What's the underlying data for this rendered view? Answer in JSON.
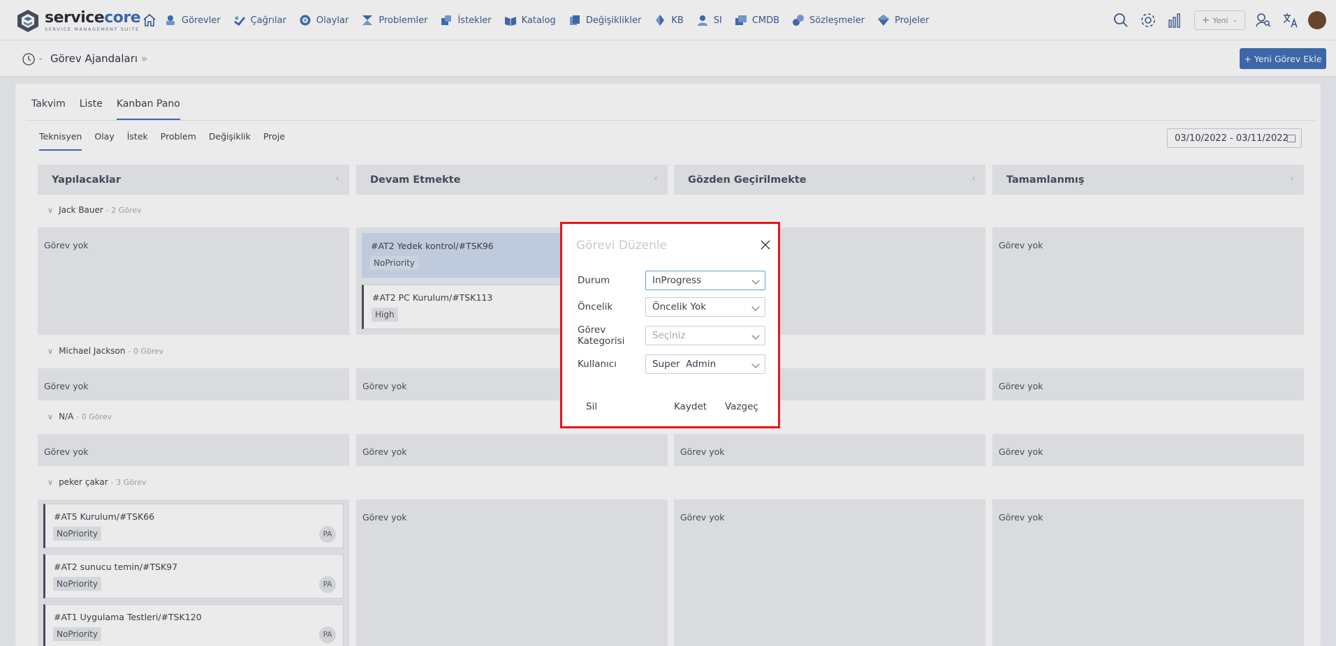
{
  "brand": {
    "name_a": "service",
    "name_b": "core",
    "tagline": "SERVICE MANAGEMENT SUITE"
  },
  "nav": [
    {
      "label": "Görevler",
      "icon": "tasks-icon"
    },
    {
      "label": "Çağrılar",
      "icon": "calls-icon"
    },
    {
      "label": "Olaylar",
      "icon": "incidents-icon"
    },
    {
      "label": "Problemler",
      "icon": "problems-icon"
    },
    {
      "label": "İstekler",
      "icon": "requests-icon"
    },
    {
      "label": "Katalog",
      "icon": "catalog-icon"
    },
    {
      "label": "Değişiklikler",
      "icon": "changes-icon"
    },
    {
      "label": "KB",
      "icon": "kb-icon"
    },
    {
      "label": "SI",
      "icon": "si-icon"
    },
    {
      "label": "CMDB",
      "icon": "cmdb-icon"
    },
    {
      "label": "Sözleşmeler",
      "icon": "contracts-icon"
    },
    {
      "label": "Projeler",
      "icon": "projects-icon"
    }
  ],
  "top_right": {
    "new_label": "Yeni"
  },
  "header": {
    "title": "Görev Ajandaları",
    "add_button": "+ Yeni Görev Ekle"
  },
  "view_tabs": [
    "Takvim",
    "Liste",
    "Kanban Pano"
  ],
  "type_tabs": [
    "Teknisyen",
    "Olay",
    "İstek",
    "Problem",
    "Değişiklik",
    "Proje"
  ],
  "date_range": "03/10/2022 - 03/11/2022",
  "columns": [
    "Yapılacaklar",
    "Devam Etmekte",
    "Gözden Geçirilmekte",
    "Tamamlanmış"
  ],
  "empty_label": "Görev yok",
  "groups": [
    {
      "name": "Jack Bauer",
      "count": "- 2 Görev"
    },
    {
      "name": "Michael Jackson",
      "count": "- 0 Görev"
    },
    {
      "name": "N/A",
      "count": "- 0 Görev"
    },
    {
      "name": "peker çakar",
      "count": "- 3 Görev"
    }
  ],
  "tasks": {
    "jack_inprogress_1": {
      "title": "#AT2 Yedek kontrol/#TSK96",
      "priority": "NoPriority"
    },
    "jack_inprogress_2": {
      "title": "#AT2 PC Kurulum/#TSK113",
      "priority": "High"
    },
    "peker_todo_1": {
      "title": "#AT5 Kurulum/#TSK66",
      "priority": "NoPriority",
      "initials": "PA"
    },
    "peker_todo_2": {
      "title": "#AT2 sunucu temin/#TSK97",
      "priority": "NoPriority",
      "initials": "PA"
    },
    "peker_todo_3": {
      "title": "#AT1 Uygulama Testleri/#TSK120",
      "priority": "NoPriority",
      "initials": "PA"
    }
  },
  "modal": {
    "title": "Görevi Düzenle",
    "fields": [
      {
        "label": "Durum",
        "value": "InProgress"
      },
      {
        "label": "Öncelik",
        "value": "Öncelik Yok"
      },
      {
        "label_line1": "Görev",
        "label_line2": "Kategorisi",
        "placeholder": "Seçiniz"
      },
      {
        "label": "Kullanıcı",
        "value": "Super  Admin"
      }
    ],
    "delete_label": "Sil",
    "save_label": "Kaydet",
    "cancel_label": "Vazgeç"
  }
}
